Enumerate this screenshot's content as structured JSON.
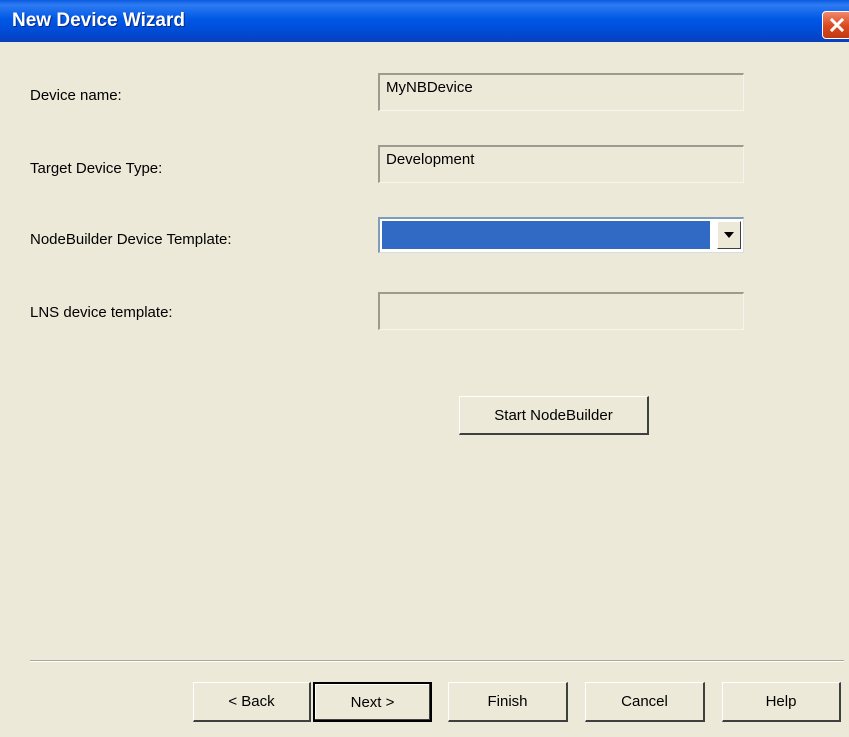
{
  "window": {
    "title": "New Device Wizard",
    "close_icon": "close-icon"
  },
  "form": {
    "device_name": {
      "label": "Device name:",
      "value": "MyNBDevice"
    },
    "target_device_type": {
      "label": "Target Device Type:",
      "value": "Development"
    },
    "nodebuilder_template": {
      "label": "NodeBuilder Device Template:",
      "value": "",
      "selected": true
    },
    "lns_template": {
      "label": "LNS device template:",
      "value": ""
    }
  },
  "actions": {
    "start_nodebuilder": "Start NodeBuilder"
  },
  "footer": {
    "back": "< Back",
    "next": "Next >",
    "finish": "Finish",
    "cancel": "Cancel",
    "help": "Help"
  },
  "colors": {
    "title_bar": "#0058E6",
    "dialog_bg": "#ECE9D8",
    "selection": "#316AC5",
    "close_button": "#D9481E"
  }
}
